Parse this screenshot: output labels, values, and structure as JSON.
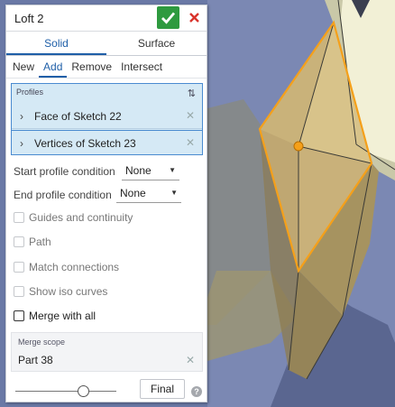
{
  "feature_dialog": {
    "title": "Loft 2",
    "ok_icon": "check-icon",
    "cancel_icon": "close-icon",
    "mode_tabs": [
      {
        "label": "Solid",
        "selected": true
      },
      {
        "label": "Surface",
        "selected": false
      }
    ],
    "operations": [
      {
        "label": "New",
        "selected": false
      },
      {
        "label": "Add",
        "selected": true
      },
      {
        "label": "Remove",
        "selected": false
      },
      {
        "label": "Intersect",
        "selected": false
      }
    ],
    "profiles": {
      "label": "Profiles",
      "items": [
        {
          "label": "Face of Sketch 22"
        },
        {
          "label": "Vertices of Sketch 23"
        }
      ]
    },
    "start_condition": {
      "label": "Start profile condition",
      "value": "None"
    },
    "end_condition": {
      "label": "End profile condition",
      "value": "None"
    },
    "options": [
      {
        "label": "Guides and continuity",
        "checked": false,
        "enabled": false
      },
      {
        "label": "Path",
        "checked": false,
        "enabled": false
      },
      {
        "label": "Match connections",
        "checked": false,
        "enabled": false
      },
      {
        "label": "Show iso curves",
        "checked": false,
        "enabled": false
      },
      {
        "label": "Merge with all",
        "checked": false,
        "enabled": true
      }
    ],
    "merge_scope": {
      "label": "Merge scope",
      "value": "Part 38"
    },
    "final_button": "Final",
    "help": "?",
    "rollback_slider": {
      "position": 0.67
    }
  },
  "colors": {
    "accent": "#1f5fa8",
    "ok_green": "#2e9a3f",
    "cancel_red": "#d9332b",
    "selection_bg": "#d5e9f5",
    "highlight_orange": "#f5a01a",
    "viewport_bg": "#6a79a6"
  }
}
